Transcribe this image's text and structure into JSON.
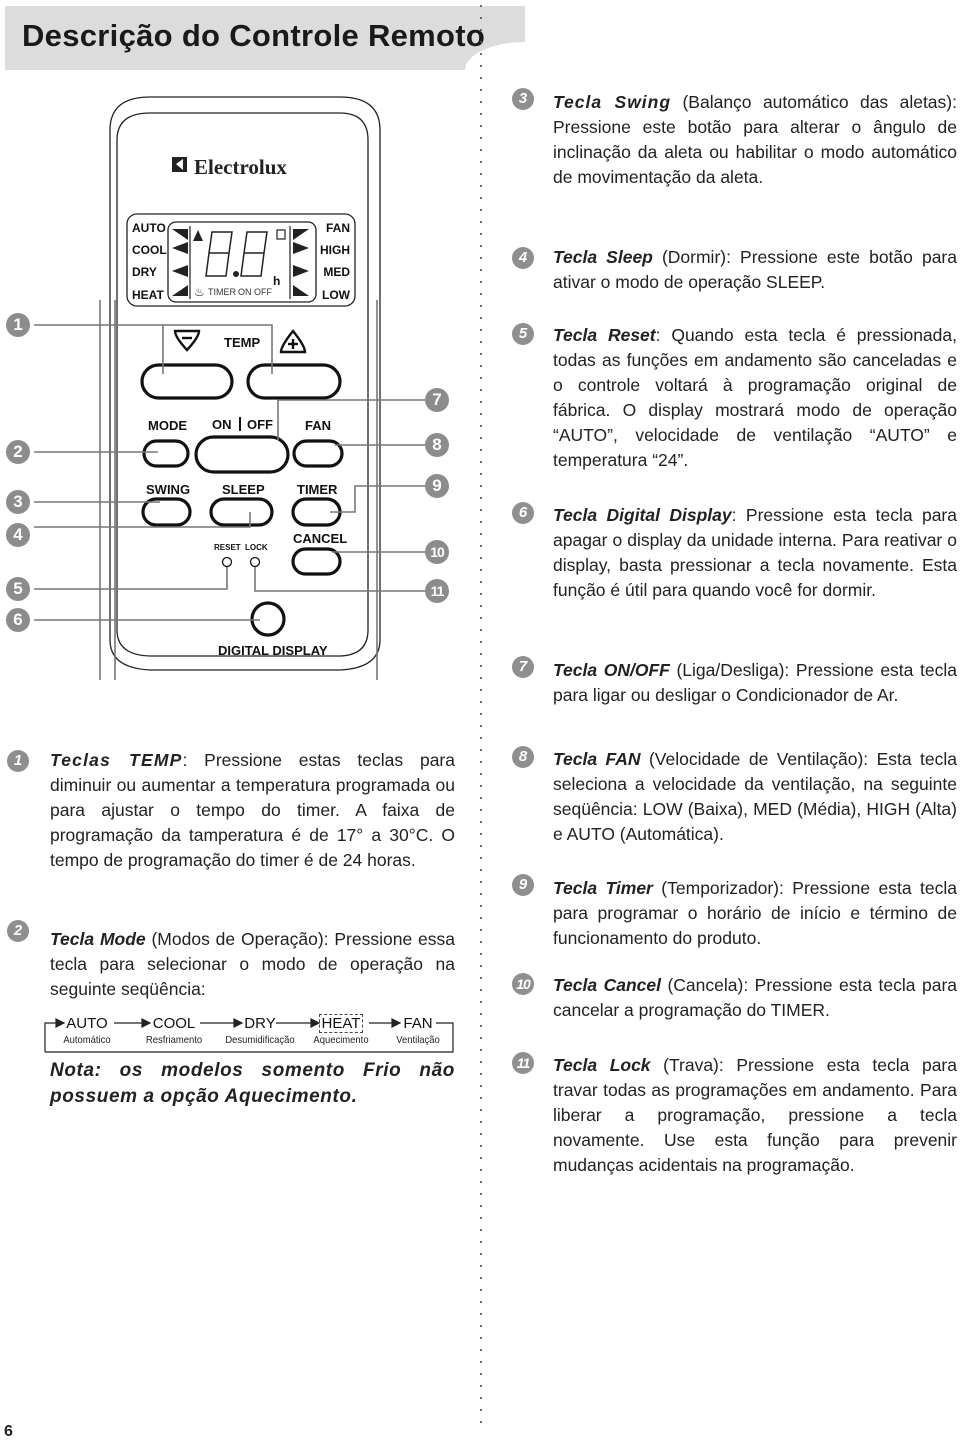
{
  "header": {
    "title": "Descrição do Controle Remoto"
  },
  "remote": {
    "brand": "Electrolux",
    "display": {
      "modes_left": [
        "AUTO",
        "COOL",
        "DRY",
        "HEAT"
      ],
      "fan_right": [
        "FAN",
        "HIGH",
        "MED",
        "LOW"
      ],
      "digits": "8.8",
      "unit": "h",
      "timer_label": "TIMER",
      "onoff_label": "ON OFF"
    },
    "buttons": {
      "temp": "TEMP",
      "minus": "−",
      "plus": "+",
      "mode": "MODE",
      "on": "ON",
      "off": "OFF",
      "fan": "FAN",
      "swing": "SWING",
      "sleep": "SLEEP",
      "timer": "TIMER",
      "reset": "RESET",
      "lock": "LOCK",
      "cancel": "CANCEL",
      "digital_display": "DIGITAL DISPLAY"
    },
    "callouts_left": [
      "1",
      "2",
      "3",
      "4",
      "5",
      "6"
    ],
    "callouts_right": [
      "7",
      "8",
      "9",
      "10",
      "11"
    ]
  },
  "items": [
    {
      "num": "1",
      "lead": "Teclas TEMP",
      "text": ": Pressione estas teclas para diminuir ou aumentar a temperatura programada ou para ajustar o tempo do timer. A faixa de programação da tamperatura é de 17° a 30°C. O tempo de programação do timer é de 24 horas."
    },
    {
      "num": "2",
      "lead": "Tecla Mode",
      "text": " (Modos de Operação): Pressione essa tecla para selecionar o modo de operação na seguinte seqüência:"
    },
    {
      "num": "3",
      "lead": "Tecla Swing",
      "text": " (Balanço automático das aletas): Pressione este botão para alterar o ângulo de inclinação da aleta ou habilitar o modo automático de movimentação da aleta."
    },
    {
      "num": "4",
      "lead": "Tecla Sleep",
      "text": " (Dormir): Pressione este botão para ativar o modo de operação SLEEP."
    },
    {
      "num": "5",
      "lead": "Tecla Reset",
      "text": ": Quando esta tecla é pressionada, todas as funções em andamento são canceladas e o controle voltará à programação original de fábrica. O display mostrará modo de operação “AUTO”, velocidade de ventilação “AUTO” e temperatura “24”."
    },
    {
      "num": "6",
      "lead": "Tecla Digital Display",
      "text": ": Pressione esta tecla para apagar o display da unidade interna. Para reativar o display, basta pressionar a tecla novamente. Esta função é útil para quando você for dormir."
    },
    {
      "num": "7",
      "lead": "Tecla ON/OFF",
      "text": " (Liga/Desliga): Pressione esta tecla para ligar ou desligar o Condicionador de Ar."
    },
    {
      "num": "8",
      "lead": "Tecla FAN",
      "text": " (Velocidade de Ventilação): Esta tecla seleciona a velocidade da ventilação, na seguinte seqüência: LOW (Baixa), MED (Média), HIGH (Alta) e AUTO (Automática)."
    },
    {
      "num": "9",
      "lead": "Tecla Timer",
      "text": " (Temporizador): Pressione esta tecla para programar o horário de início e término de funcionamento do produto."
    },
    {
      "num": "10",
      "lead": "Tecla Cancel",
      "text": " (Cancela): Pressione esta tecla para cancelar a programação do TIMER."
    },
    {
      "num": "11",
      "lead": "Tecla Lock",
      "text": " (Trava): Pressione esta tecla para travar todas as programações em andamento. Para liberar a programação, pressione a tecla novamente. Use esta função para prevenir mudanças acidentais na programação."
    }
  ],
  "mode_sequence": [
    {
      "mode": "AUTO",
      "label": "Automático"
    },
    {
      "mode": "COOL",
      "label": "Resfriamento"
    },
    {
      "mode": "DRY",
      "label": "Desumidificação"
    },
    {
      "mode": "HEAT",
      "label": "Aquecimento"
    },
    {
      "mode": "FAN",
      "label": "Ventilação"
    }
  ],
  "note": "Nota: os modelos somento Frio não possuem a opção Aquecimento.",
  "footer": {
    "page_number": "6"
  }
}
